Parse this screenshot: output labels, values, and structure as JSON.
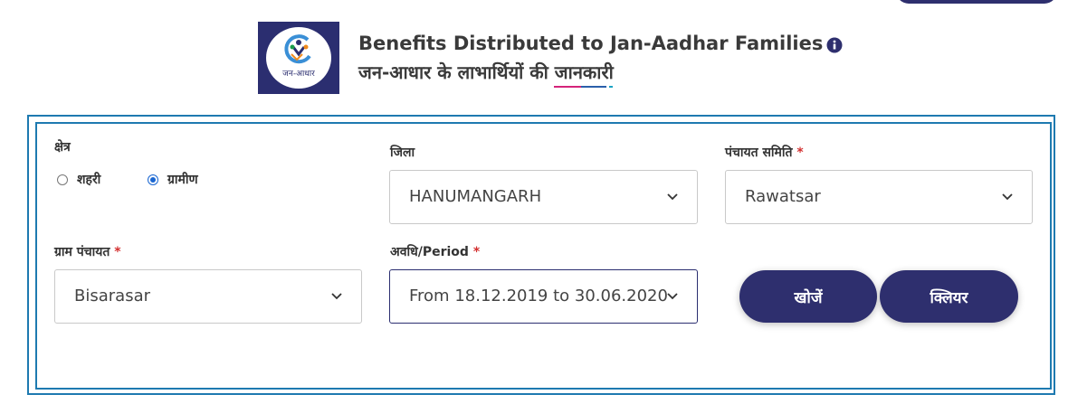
{
  "header": {
    "logo_text": "जन-आधार",
    "title_en": "Benefits Distributed to Jan-Aadhar Families",
    "title_hi": "जन-आधार के लाभार्थियों की जानकारी"
  },
  "filters": {
    "area": {
      "label": "क्षेत्र",
      "options": [
        "शहरी",
        "ग्रामीण"
      ],
      "selected": "ग्रामीण"
    },
    "district": {
      "label": "जिला",
      "value": "HANUMANGARH"
    },
    "panchayat_samiti": {
      "label": "पंचायत समिति",
      "required_mark": "*",
      "value": "Rawatsar"
    },
    "gram_panchayat": {
      "label": "ग्राम पंचायत",
      "required_mark": "*",
      "value": "Bisarasar"
    },
    "period": {
      "label": "अवधि/Period",
      "required_mark": "*",
      "value": "From 18.12.2019 to 30.06.2020"
    }
  },
  "buttons": {
    "search": "खोजें",
    "clear": "क्लियर"
  },
  "colors": {
    "primary": "#2e2f6e",
    "panel_border": "#1e7ab0",
    "required": "#d32f2f",
    "underline_pink": "#d4237a",
    "underline_blue": "#2b5faa",
    "underline_teal": "#1ba3c4"
  }
}
